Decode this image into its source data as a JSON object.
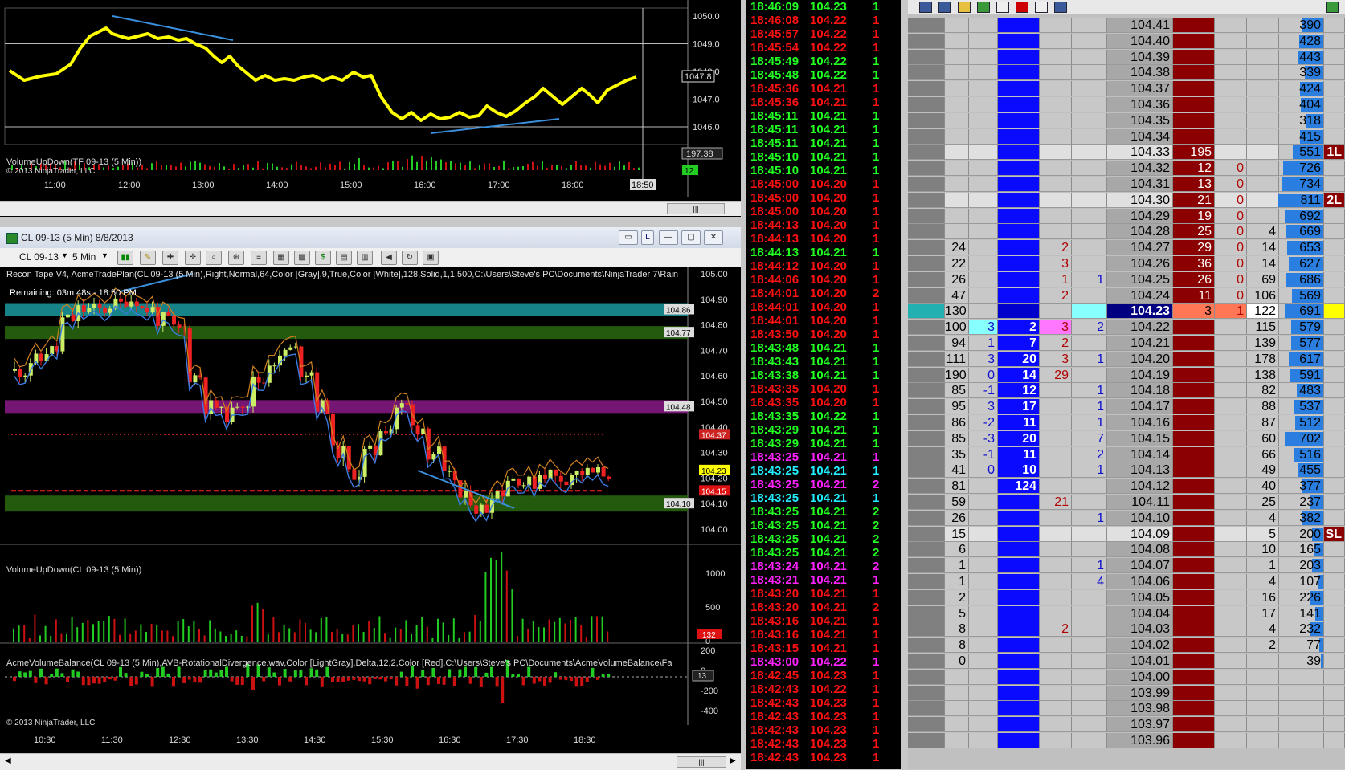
{
  "top_chart": {
    "indicator_label": "VolumeUpDown(TF 09-13 (5 Min))",
    "copyright": "© 2013 NinjaTrader, LLC",
    "y_ticks": [
      "1050.0",
      "1049.0",
      "1048.0",
      "1047.0",
      "1046.0"
    ],
    "last_price": "1047.8",
    "volume_value": "197.38",
    "green_tag": "12",
    "x_ticks": [
      "11:00",
      "12:00",
      "13:00",
      "14:00",
      "15:00",
      "16:00",
      "17:00",
      "18:00"
    ],
    "time_marker": "18:50"
  },
  "chart_window": {
    "title": "CL 09-13 (5 Min)  8/8/2013",
    "instrument": "CL 09-13",
    "interval": "5 Min",
    "indicator_label": "Recon Tape V4, AcmeTradePlan(CL 09-13 (5 Min),Right,Normal,64,Color [Gray],9,True,Color [White],128,Solid,1,1,500,C:\\Users\\Steve's PC\\Documents\\NinjaTrader 7\\Rain",
    "remaining": "Remaining: 03m 48s - 18:50 PM",
    "y_ticks": [
      "105.00",
      "104.90",
      "104.80",
      "104.70",
      "104.60",
      "104.50",
      "104.40",
      "104.30",
      "104.20",
      "104.10",
      "104.00"
    ],
    "level_tags": [
      "104.86",
      "104.77",
      "104.48",
      "104.37",
      "104.23",
      "104.15",
      "104.10"
    ],
    "volume_label": "VolumeUpDown(CL 09-13 (5 Min))",
    "volume_ticks": [
      "1000",
      "500",
      "0"
    ],
    "volume_tag": "132",
    "balance_label": "AcmeVolumeBalance(CL 09-13 (5 Min),AVB-RotationalDivergence.wav,Color [LightGray],Delta,12,2,Color [Red],C:\\Users\\Steve's PC\\Documents\\AcmeVolumeBalance\\Fa",
    "balance_ticks": [
      "200",
      "0",
      "-200",
      "-400"
    ],
    "balance_tag": "13",
    "copyright": "© 2013 NinjaTrader, LLC",
    "x_ticks": [
      "10:30",
      "11:30",
      "12:30",
      "13:30",
      "14:30",
      "15:30",
      "16:30",
      "17:30",
      "18:30"
    ],
    "scroll_thumb": "|||"
  },
  "time_and_sales": [
    [
      "18:46:09",
      "104.23",
      "1",
      "g"
    ],
    [
      "18:46:08",
      "104.22",
      "1",
      "r"
    ],
    [
      "18:45:57",
      "104.22",
      "1",
      "r"
    ],
    [
      "18:45:54",
      "104.22",
      "1",
      "r"
    ],
    [
      "18:45:49",
      "104.22",
      "1",
      "g"
    ],
    [
      "18:45:48",
      "104.22",
      "1",
      "g"
    ],
    [
      "18:45:36",
      "104.21",
      "1",
      "r"
    ],
    [
      "18:45:36",
      "104.21",
      "1",
      "r"
    ],
    [
      "18:45:11",
      "104.21",
      "1",
      "g"
    ],
    [
      "18:45:11",
      "104.21",
      "1",
      "g"
    ],
    [
      "18:45:11",
      "104.21",
      "1",
      "g"
    ],
    [
      "18:45:10",
      "104.21",
      "1",
      "g"
    ],
    [
      "18:45:10",
      "104.21",
      "1",
      "g"
    ],
    [
      "18:45:00",
      "104.20",
      "1",
      "r"
    ],
    [
      "18:45:00",
      "104.20",
      "1",
      "r"
    ],
    [
      "18:45:00",
      "104.20",
      "1",
      "r"
    ],
    [
      "18:44:13",
      "104.20",
      "1",
      "r"
    ],
    [
      "18:44:13",
      "104.20",
      "1",
      "r"
    ],
    [
      "18:44:13",
      "104.21",
      "1",
      "g"
    ],
    [
      "18:44:12",
      "104.20",
      "1",
      "r"
    ],
    [
      "18:44:06",
      "104.20",
      "1",
      "r"
    ],
    [
      "18:44:01",
      "104.20",
      "2",
      "r"
    ],
    [
      "18:44:01",
      "104.20",
      "1",
      "r"
    ],
    [
      "18:44:01",
      "104.20",
      "1",
      "r"
    ],
    [
      "18:43:50",
      "104.20",
      "1",
      "r"
    ],
    [
      "18:43:48",
      "104.21",
      "1",
      "g"
    ],
    [
      "18:43:43",
      "104.21",
      "1",
      "g"
    ],
    [
      "18:43:38",
      "104.21",
      "1",
      "g"
    ],
    [
      "18:43:35",
      "104.20",
      "1",
      "r"
    ],
    [
      "18:43:35",
      "104.20",
      "1",
      "r"
    ],
    [
      "18:43:35",
      "104.22",
      "1",
      "g"
    ],
    [
      "18:43:29",
      "104.21",
      "1",
      "g"
    ],
    [
      "18:43:29",
      "104.21",
      "1",
      "g"
    ],
    [
      "18:43:25",
      "104.21",
      "1",
      "m"
    ],
    [
      "18:43:25",
      "104.21",
      "1",
      "c"
    ],
    [
      "18:43:25",
      "104.21",
      "2",
      "m"
    ],
    [
      "18:43:25",
      "104.21",
      "1",
      "c"
    ],
    [
      "18:43:25",
      "104.21",
      "2",
      "g"
    ],
    [
      "18:43:25",
      "104.21",
      "2",
      "g"
    ],
    [
      "18:43:25",
      "104.21",
      "2",
      "g"
    ],
    [
      "18:43:25",
      "104.21",
      "2",
      "g"
    ],
    [
      "18:43:24",
      "104.21",
      "2",
      "m"
    ],
    [
      "18:43:21",
      "104.21",
      "1",
      "m"
    ],
    [
      "18:43:20",
      "104.21",
      "1",
      "r"
    ],
    [
      "18:43:20",
      "104.21",
      "2",
      "r"
    ],
    [
      "18:43:16",
      "104.21",
      "1",
      "r"
    ],
    [
      "18:43:16",
      "104.21",
      "1",
      "r"
    ],
    [
      "18:43:15",
      "104.21",
      "1",
      "r"
    ],
    [
      "18:43:00",
      "104.22",
      "1",
      "m"
    ],
    [
      "18:42:45",
      "104.23",
      "1",
      "r"
    ],
    [
      "18:42:43",
      "104.22",
      "1",
      "r"
    ],
    [
      "18:42:43",
      "104.23",
      "1",
      "r"
    ],
    [
      "18:42:43",
      "104.23",
      "1",
      "r"
    ],
    [
      "18:42:43",
      "104.23",
      "1",
      "r"
    ],
    [
      "18:42:43",
      "104.23",
      "1",
      "r"
    ],
    [
      "18:42:43",
      "104.23",
      "1",
      "r"
    ]
  ],
  "dom_ladder": [
    {
      "price": "104.41",
      "ask": "",
      "s": "390"
    },
    {
      "price": "104.40",
      "ask": "",
      "s": "428"
    },
    {
      "price": "104.39",
      "ask": "",
      "s": "443"
    },
    {
      "price": "104.38",
      "ask": "",
      "s": "339"
    },
    {
      "price": "104.37",
      "ask": "",
      "s": "424"
    },
    {
      "price": "104.36",
      "ask": "",
      "s": "404"
    },
    {
      "price": "104.35",
      "ask": "",
      "s": "318"
    },
    {
      "price": "104.34",
      "ask": "",
      "s": "415"
    },
    {
      "price": "104.33",
      "ask": "195",
      "s": "551",
      "flag": "1L",
      "hl": true
    },
    {
      "price": "104.32",
      "ask": "12",
      "a2": "0",
      "s": "726"
    },
    {
      "price": "104.31",
      "ask": "13",
      "a2": "0",
      "s": "734"
    },
    {
      "price": "104.30",
      "ask": "21",
      "a2": "0",
      "s": "811",
      "flag": "2L",
      "hl": true
    },
    {
      "price": "104.29",
      "ask": "19",
      "a2": "0",
      "s": "692"
    },
    {
      "price": "104.28",
      "ask": "25",
      "a2": "0",
      "b2": "4",
      "s": "669"
    },
    {
      "price": "104.27",
      "c1": "24",
      "c4": "2",
      "ask": "29",
      "a2": "0",
      "b2": "14",
      "s": "653"
    },
    {
      "price": "104.26",
      "c1": "22",
      "c4": "3",
      "ask": "36",
      "a2": "0",
      "b2": "14",
      "s": "627"
    },
    {
      "price": "104.25",
      "c1": "26",
      "c4": "1",
      "c5": "1",
      "ask": "26",
      "a2": "0",
      "b2": "69",
      "s": "686"
    },
    {
      "price": "104.24",
      "c1": "47",
      "c4": "2",
      "ask": "11",
      "a2": "0",
      "b2": "106",
      "s": "569"
    },
    {
      "price": "104.23",
      "c1": "130",
      "ask": "3",
      "a2": "1",
      "b2": "122",
      "s": "691",
      "last": true
    },
    {
      "price": "104.22",
      "c1": "100",
      "c2": "3",
      "c3": "2",
      "c4": "3",
      "c5": "2",
      "b2": "115",
      "s": "579"
    },
    {
      "price": "104.21",
      "c1": "94",
      "c2": "1",
      "c3": "7",
      "c4": "2",
      "b2": "139",
      "s": "577"
    },
    {
      "price": "104.20",
      "c1": "111",
      "c2": "3",
      "c3": "20",
      "c4": "3",
      "c5": "1",
      "b2": "178",
      "s": "617"
    },
    {
      "price": "104.19",
      "c1": "190",
      "c2": "0",
      "c3": "14",
      "c4": "29",
      "b2": "138",
      "s": "591"
    },
    {
      "price": "104.18",
      "c1": "85",
      "c2": "-1",
      "c3": "12",
      "c5": "1",
      "b2": "82",
      "s": "483"
    },
    {
      "price": "104.17",
      "c1": "95",
      "c2": "3",
      "c3": "17",
      "c5": "1",
      "b2": "88",
      "s": "537"
    },
    {
      "price": "104.16",
      "c1": "86",
      "c2": "-2",
      "c3": "11",
      "c5": "1",
      "b2": "87",
      "s": "512"
    },
    {
      "price": "104.15",
      "c1": "85",
      "c2": "-3",
      "c3": "20",
      "c5": "7",
      "b2": "60",
      "s": "702"
    },
    {
      "price": "104.14",
      "c1": "35",
      "c2": "-1",
      "c3": "11",
      "c5": "2",
      "b2": "66",
      "s": "516"
    },
    {
      "price": "104.13",
      "c1": "41",
      "c2": "0",
      "c3": "10",
      "c5": "1",
      "b2": "49",
      "s": "455"
    },
    {
      "price": "104.12",
      "c1": "81",
      "c3": "124",
      "b2": "40",
      "s": "377"
    },
    {
      "price": "104.11",
      "c1": "59",
      "c4": "21",
      "b2": "25",
      "s": "237"
    },
    {
      "price": "104.10",
      "c1": "26",
      "c5": "1",
      "b2": "4",
      "s": "382"
    },
    {
      "price": "104.09",
      "c1": "15",
      "b2": "5",
      "s": "200",
      "flag": "SL",
      "hl": true
    },
    {
      "price": "104.08",
      "c1": "6",
      "b2": "10",
      "s": "165"
    },
    {
      "price": "104.07",
      "c1": "1",
      "c5": "1",
      "b2": "1",
      "s": "203"
    },
    {
      "price": "104.06",
      "c1": "1",
      "c5": "4",
      "b2": "4",
      "s": "107"
    },
    {
      "price": "104.05",
      "c1": "2",
      "b2": "16",
      "s": "226"
    },
    {
      "price": "104.04",
      "c1": "5",
      "b2": "17",
      "s": "141"
    },
    {
      "price": "104.03",
      "c1": "8",
      "c4": "2",
      "b2": "4",
      "s": "232"
    },
    {
      "price": "104.02",
      "c1": "8",
      "b2": "2",
      "s": "77"
    },
    {
      "price": "104.01",
      "c1": "0",
      "s": "39"
    },
    {
      "price": "104.00"
    },
    {
      "price": "103.99"
    },
    {
      "price": "103.98"
    },
    {
      "price": "103.97"
    },
    {
      "price": "103.96"
    }
  ],
  "colors": {
    "up": "#22dd22",
    "down": "#dd1111",
    "blue": "#0a0aff",
    "maroon": "#8b0000",
    "yellow": "#ffff00"
  }
}
